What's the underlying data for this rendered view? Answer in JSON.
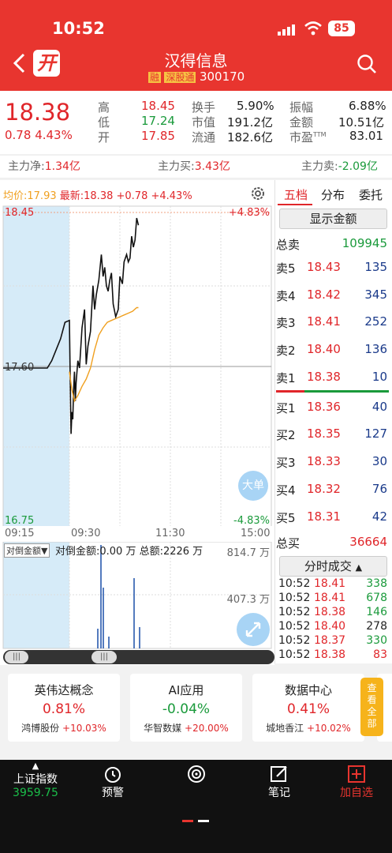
{
  "status": {
    "time": "10:52",
    "battery": "85"
  },
  "header": {
    "badge_open": "开",
    "stock_name": "汉得信息",
    "tag_margin": "融",
    "tag_connect": "深股通",
    "code": "300170"
  },
  "quote": {
    "price": "18.38",
    "change": "0.78",
    "change_pct": "4.43%",
    "high_label": "高",
    "high": "18.45",
    "low_label": "低",
    "low": "17.24",
    "open_label": "开",
    "open": "17.85",
    "turnover_label": "换手",
    "turnover": "5.90%",
    "mktcap_label": "市值",
    "mktcap": "191.2亿",
    "float_label": "流通",
    "float": "182.6亿",
    "amplitude_label": "振幅",
    "amplitude": "6.88%",
    "amount_label": "金额",
    "amount": "10.51亿",
    "pe_label": "市盈",
    "pe_sup": "TTM",
    "pe": "83.01"
  },
  "capital_flow": {
    "net_label": "主力净:",
    "net": "1.34亿",
    "buy_label": "主力买:",
    "buy": "3.43亿",
    "sell_label": "主力卖:",
    "sell": "-2.09亿"
  },
  "chart_header": {
    "avg_label": "均价:",
    "avg": "17.93",
    "last_label": "最新:",
    "last": "18.38",
    "chg": "+0.78",
    "chg_pct": "+4.43%"
  },
  "chart_data": {
    "type": "line",
    "title": "",
    "xlabel": "",
    "ylabel": "",
    "x_ticks": [
      "09:15",
      "09:30",
      "11:30",
      "15:00"
    ],
    "ylim": [
      16.75,
      18.45
    ],
    "y_left_ticks": [
      "18.45",
      "17.60",
      "16.75"
    ],
    "y_right_ticks": [
      "+4.83%",
      "-4.83%"
    ],
    "prev_close": 17.6,
    "series": [
      {
        "color": "#111111",
        "x": [
          "09:15",
          "09:20",
          "09:24",
          "09:25",
          "09:26",
          "09:27",
          "09:28",
          "09:29",
          "09:30",
          "09:31",
          "09:32",
          "09:33",
          "09:34",
          "09:35",
          "09:36",
          "09:37",
          "09:38",
          "09:40",
          "09:42",
          "09:45",
          "09:48",
          "09:50",
          "09:52",
          "09:55",
          "09:58",
          "10:00",
          "10:02",
          "10:05",
          "10:08",
          "10:10",
          "10:12",
          "10:14",
          "10:16",
          "10:18",
          "10:20",
          "10:22",
          "10:25",
          "10:28",
          "10:30",
          "10:33",
          "10:35",
          "10:38",
          "10:40",
          "10:42",
          "10:44",
          "10:46",
          "10:48",
          "10:50",
          "10:52"
        ],
        "values": [
          17.6,
          17.6,
          17.6,
          17.6,
          17.64,
          17.7,
          17.76,
          17.85,
          17.86,
          17.52,
          17.24,
          17.36,
          17.32,
          17.48,
          17.58,
          17.42,
          17.52,
          17.64,
          17.6,
          17.82,
          17.92,
          17.62,
          17.72,
          17.8,
          18.05,
          17.92,
          18.0,
          18.08,
          18.22,
          18.1,
          18.15,
          18.05,
          18.02,
          18.08,
          18.12,
          17.95,
          17.88,
          17.92,
          18.1,
          18.06,
          18.18,
          18.22,
          18.18,
          18.2,
          18.32,
          18.26,
          18.3,
          18.42,
          18.38
        ]
      },
      {
        "color": "#f0a020",
        "x": [
          "09:30",
          "09:33",
          "09:36",
          "09:40",
          "09:45",
          "09:50",
          "09:55",
          "10:00",
          "10:05",
          "10:10",
          "10:15",
          "10:20",
          "10:25",
          "10:30",
          "10:35",
          "10:40",
          "10:45",
          "10:50",
          "10:52"
        ],
        "values": [
          17.58,
          17.48,
          17.42,
          17.45,
          17.5,
          17.54,
          17.6,
          17.7,
          17.78,
          17.82,
          17.85,
          17.86,
          17.87,
          17.88,
          17.89,
          17.9,
          17.91,
          17.93,
          17.93
        ]
      }
    ]
  },
  "vol_panel": {
    "selector": "对倒金额",
    "info": "对倒金额:0.00 万 总额:2226 万",
    "axis_top": "814.7 万",
    "axis_mid": "407.3 万"
  },
  "orderbook": {
    "tabs": [
      "五档",
      "分布",
      "委托"
    ],
    "show_amount_btn": "显示金额",
    "total_sell_label": "总卖",
    "total_sell": "109945",
    "asks": [
      {
        "label": "卖5",
        "price": "18.43",
        "vol": "135"
      },
      {
        "label": "卖4",
        "price": "18.42",
        "vol": "345"
      },
      {
        "label": "卖3",
        "price": "18.41",
        "vol": "252"
      },
      {
        "label": "卖2",
        "price": "18.40",
        "vol": "136"
      },
      {
        "label": "卖1",
        "price": "18.38",
        "vol": "10"
      }
    ],
    "bids": [
      {
        "label": "买1",
        "price": "18.36",
        "vol": "40"
      },
      {
        "label": "买2",
        "price": "18.35",
        "vol": "127"
      },
      {
        "label": "买3",
        "price": "18.33",
        "vol": "30"
      },
      {
        "label": "买4",
        "price": "18.32",
        "vol": "76"
      },
      {
        "label": "买5",
        "price": "18.31",
        "vol": "42"
      }
    ],
    "total_buy_label": "总买",
    "total_buy": "36664",
    "ticks_btn": "分时成交",
    "ticks": [
      {
        "time": "10:52",
        "price": "18.41",
        "vol": "338",
        "color": "green"
      },
      {
        "time": "10:52",
        "price": "18.41",
        "vol": "678",
        "color": "green"
      },
      {
        "time": "10:52",
        "price": "18.38",
        "vol": "146",
        "color": "green"
      },
      {
        "time": "10:52",
        "price": "18.40",
        "vol": "278",
        "color": "dark"
      },
      {
        "time": "10:52",
        "price": "18.37",
        "vol": "330",
        "color": "green"
      },
      {
        "time": "10:52",
        "price": "18.38",
        "vol": "83",
        "color": "red"
      }
    ]
  },
  "float_buttons": {
    "big_order": "大单"
  },
  "concept_cards": [
    {
      "name": "英伟达概念",
      "pct": "0.81%",
      "leader": "鸿博股份",
      "leader_pct": "+10.03%",
      "color": "red"
    },
    {
      "name": "AI应用",
      "pct": "-0.04%",
      "leader": "华智数媒",
      "leader_pct": "+20.00%",
      "color": "green"
    },
    {
      "name": "数据中心",
      "pct": "0.41%",
      "leader": "城地香江",
      "leader_pct": "+10.02%",
      "color": "red"
    }
  ],
  "view_all": "查看全部",
  "bottom_bar": {
    "index_name": "上证指数",
    "index_value": "3959.75",
    "alert": "预警",
    "notes": "笔记",
    "add_watch": "加自选"
  },
  "colors": {
    "brand_red": "#e8352f",
    "up": "#e0262a",
    "down": "#1a9a3b",
    "avg_line": "#f0a020"
  }
}
